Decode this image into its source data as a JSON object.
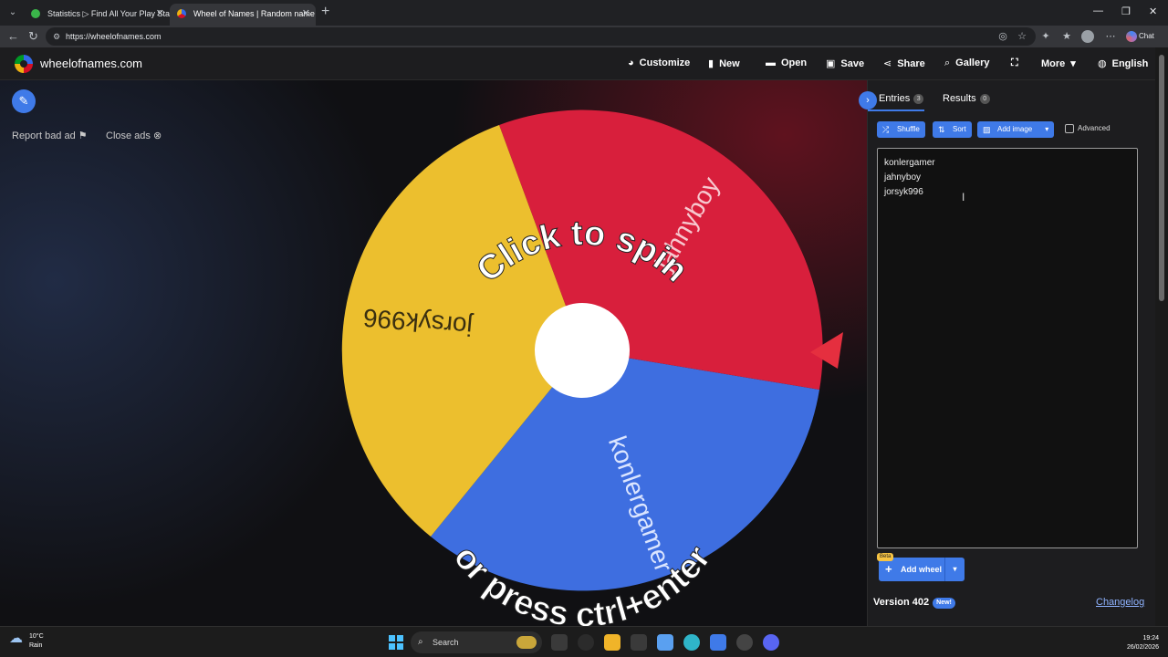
{
  "browser": {
    "tabs": [
      {
        "title": "Statistics ▷ Find All Your Play Stat"
      },
      {
        "title": "Wheel of Names | Random name p"
      }
    ],
    "url": "https://wheelofnames.com",
    "chat_label": "Chat"
  },
  "header": {
    "site_name": "wheelofnames.com",
    "nav": {
      "customize": "Customize",
      "new": "New",
      "open": "Open",
      "save": "Save",
      "share": "Share",
      "gallery": "Gallery",
      "more": "More",
      "language": "English"
    }
  },
  "stage": {
    "report_ad": "Report bad ad",
    "close_ads": "Close ads",
    "wheel": {
      "spin_text_top": "Click to spin",
      "spin_text_bottom": "or press ctrl+enter",
      "slices": [
        {
          "name": "konlergamer",
          "color": "#3e6ee0"
        },
        {
          "name": "jahnyboy",
          "color": "#d81f3c"
        },
        {
          "name": "jorsyk996",
          "color": "#ecbf2e"
        }
      ]
    }
  },
  "panel": {
    "tabs": {
      "entries_label": "Entries",
      "entries_count": "3",
      "results_label": "Results",
      "results_count": "0"
    },
    "buttons": {
      "shuffle": "Shuffle",
      "sort": "Sort",
      "add_image": "Add image",
      "advanced": "Advanced"
    },
    "entries": [
      "konlergamer",
      "jahnyboy",
      "jorsyk996"
    ],
    "add_wheel": {
      "beta": "Beta",
      "label": "Add wheel"
    },
    "version": "Version 402",
    "new_badge": "New!",
    "changelog": "Changelog"
  },
  "taskbar": {
    "weather_temp": "10°C",
    "weather_desc": "Rain",
    "search_label": "Search",
    "time": "19:24",
    "date": "26/02/2026"
  }
}
